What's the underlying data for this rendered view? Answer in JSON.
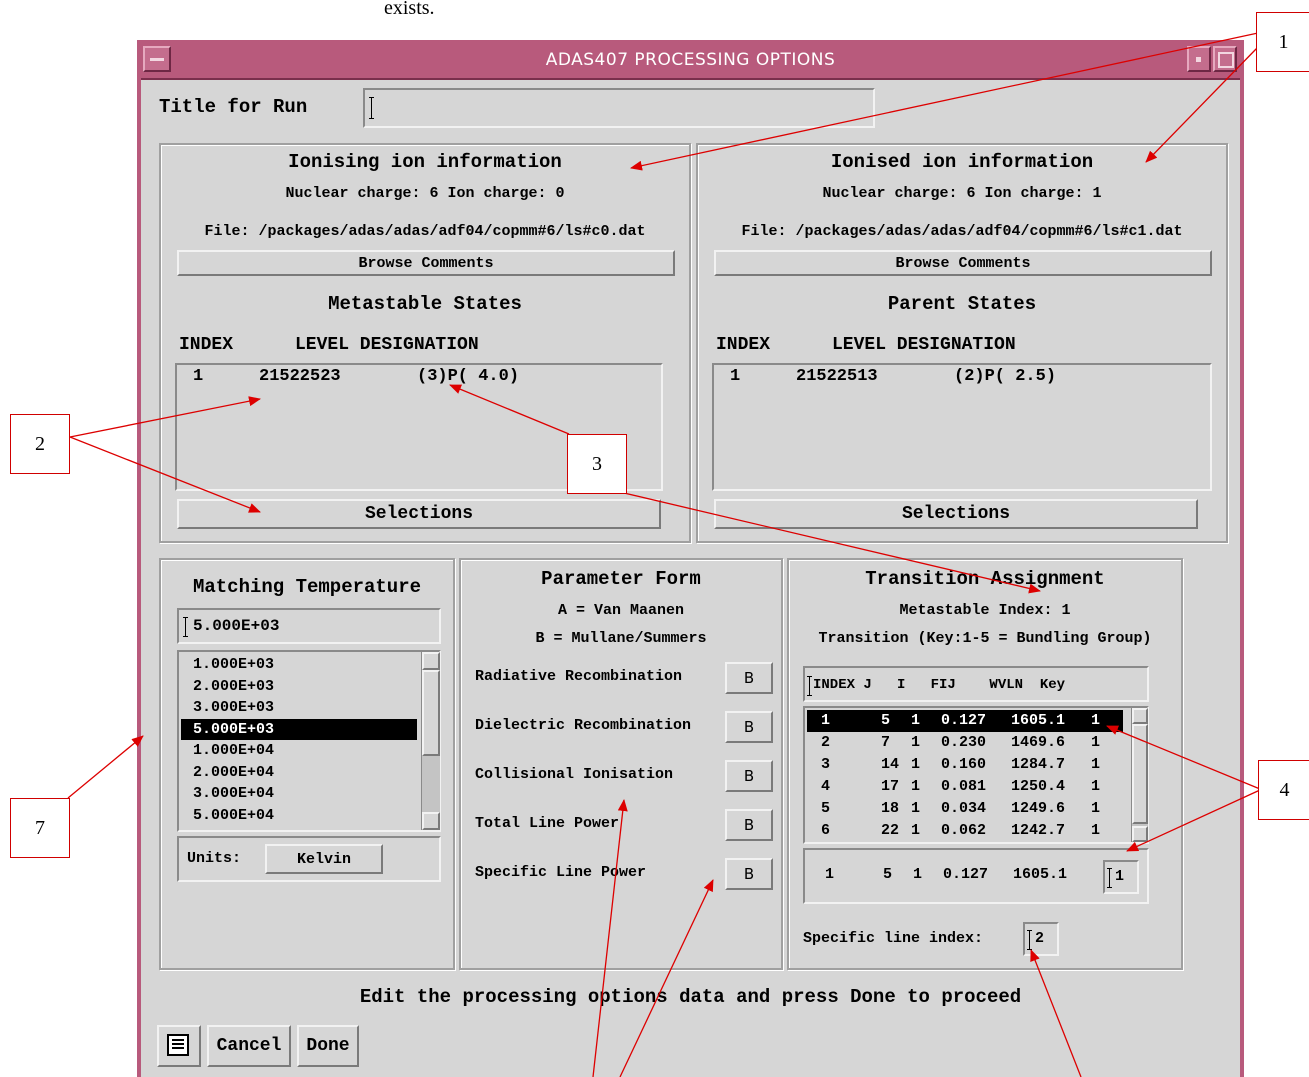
{
  "top_text": "exists.",
  "window": {
    "title": "ADAS407 PROCESSING OPTIONS",
    "title_bar_color": "#b85a7c",
    "background": "#d6d6d6"
  },
  "run_title": {
    "label": "Title for Run",
    "value": ""
  },
  "ionising": {
    "heading": "Ionising ion information",
    "charges": "Nuclear charge: 6 Ion charge: 0",
    "file": "File: /packages/adas/adas/adf04/copmm#6/ls#c0.dat",
    "browse_label": "Browse Comments",
    "states_heading": "Metastable States",
    "col_index": "INDEX",
    "col_level": "LEVEL DESIGNATION",
    "rows": [
      {
        "index": "1",
        "config": "21522523",
        "term": "(3)P( 4.0)"
      }
    ],
    "selections_label": "Selections"
  },
  "ionised": {
    "heading": "Ionised ion information",
    "charges": "Nuclear charge: 6 Ion charge: 1",
    "file": "File: /packages/adas/adas/adf04/copmm#6/ls#c1.dat",
    "browse_label": "Browse Comments",
    "states_heading": "Parent States",
    "col_index": "INDEX",
    "col_level": "LEVEL DESIGNATION",
    "rows": [
      {
        "index": "1",
        "config": "21522513",
        "term": "(2)P( 2.5)"
      }
    ],
    "selections_label": "Selections"
  },
  "matching_temp": {
    "heading": "Matching Temperature",
    "value": "5.000E+03",
    "list": [
      "1.000E+03",
      "2.000E+03",
      "3.000E+03",
      "5.000E+03",
      "1.000E+04",
      "2.000E+04",
      "3.000E+04",
      "5.000E+04"
    ],
    "selected_index": 3,
    "units_label": "Units:",
    "units_value": "Kelvin"
  },
  "parameter_form": {
    "heading": "Parameter Form",
    "option_a": "A = Van Maanen",
    "option_b": "B = Mullane/Summers",
    "rows": [
      {
        "label": "Radiative Recombination",
        "value": "B"
      },
      {
        "label": "Dielectric Recombination",
        "value": "B"
      },
      {
        "label": "Collisional Ionisation",
        "value": "B"
      },
      {
        "label": "Total Line Power",
        "value": "B"
      },
      {
        "label": "Specific Line Power",
        "value": "B"
      }
    ]
  },
  "transition": {
    "heading": "Transition Assignment",
    "metastable_index": "Metastable Index: 1",
    "key_note": "Transition (Key:1-5 = Bundling Group)",
    "header": "INDEX J   I   FIJ    WVLN  Key",
    "rows": [
      {
        "index": "1",
        "j": "5",
        "i": "1",
        "fij": "0.127",
        "wvln": "1605.1",
        "key": "1"
      },
      {
        "index": "2",
        "j": "7",
        "i": "1",
        "fij": "0.230",
        "wvln": "1469.6",
        "key": "1"
      },
      {
        "index": "3",
        "j": "14",
        "i": "1",
        "fij": "0.160",
        "wvln": "1284.7",
        "key": "1"
      },
      {
        "index": "4",
        "j": "17",
        "i": "1",
        "fij": "0.081",
        "wvln": "1250.4",
        "key": "1"
      },
      {
        "index": "5",
        "j": "18",
        "i": "1",
        "fij": "0.034",
        "wvln": "1249.6",
        "key": "1"
      },
      {
        "index": "6",
        "j": "22",
        "i": "1",
        "fij": "0.062",
        "wvln": "1242.7",
        "key": "1"
      }
    ],
    "selected_row": 0,
    "edit": {
      "index": "1",
      "j": "5",
      "i": "1",
      "fij": "0.127",
      "wvln": "1605.1",
      "key": "1"
    },
    "specific_line_label": "Specific line index:",
    "specific_line_value": "2"
  },
  "status_message": "Edit the processing options data and press Done to proceed",
  "buttons": {
    "cancel": "Cancel",
    "done": "Done"
  },
  "callouts": [
    "1",
    "2",
    "3",
    "4",
    "7"
  ],
  "annotation_color": "#dd0000"
}
